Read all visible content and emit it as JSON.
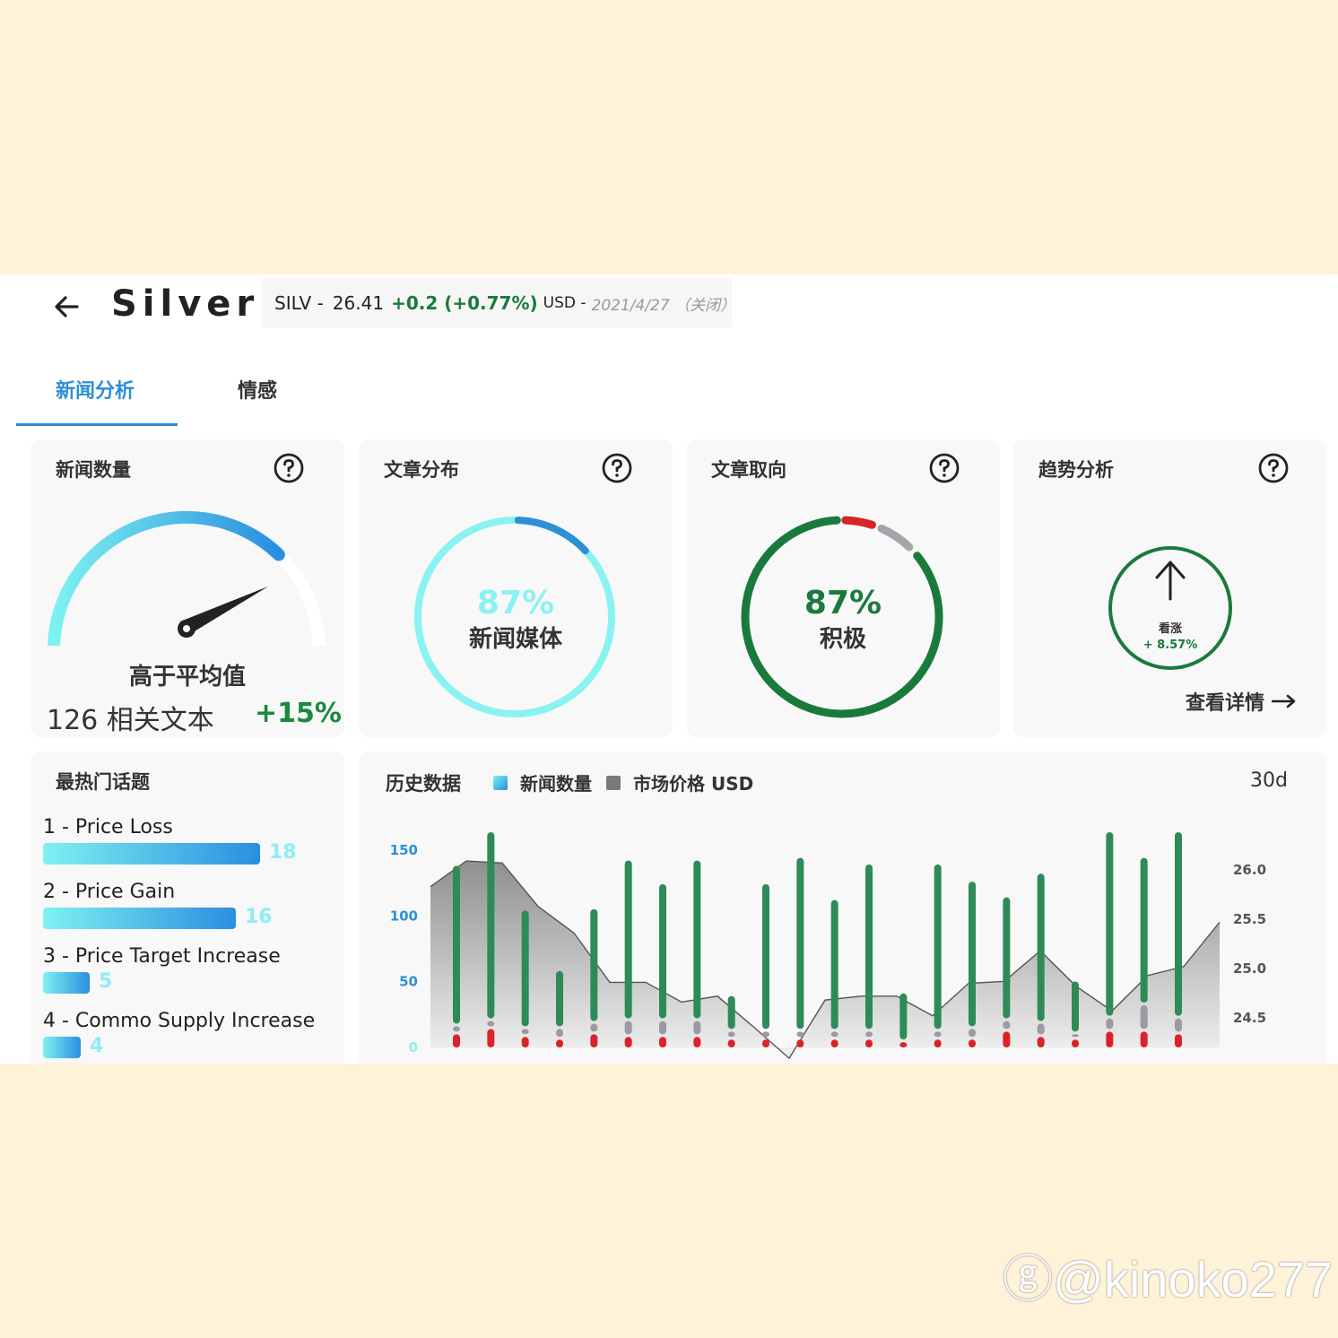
{
  "header": {
    "title": "Silver",
    "ticker": {
      "symbol": "SILV -",
      "price": "26.41",
      "change": "+0.2 (+0.77%)",
      "currency": "USD -",
      "date": "2021/4/27 （关闭）"
    }
  },
  "tabs": [
    {
      "label": "新闻分析",
      "active": true
    },
    {
      "label": "情感",
      "active": false
    }
  ],
  "cards": {
    "news_count": {
      "title": "新闻数量",
      "gauge_level": 0.72,
      "status": "高于平均值",
      "total": "126 相关文本",
      "change": "+15%"
    },
    "distribution": {
      "title": "文章分布",
      "percent": "87%",
      "label": "新闻媒体",
      "share": 0.87
    },
    "orientation": {
      "title": "文章取向",
      "percent": "87%",
      "label": "积极",
      "positive_share": 0.87
    },
    "trend": {
      "title": "趋势分析",
      "label": "看涨",
      "value": "+ 8.57%",
      "link": "查看详情"
    }
  },
  "topics": {
    "title": "最热门话题",
    "items": [
      {
        "name": "1 - Price Loss",
        "value": "18",
        "count": 18
      },
      {
        "name": "2 - Price Gain",
        "value": "16",
        "count": 16
      },
      {
        "name": "3 - Price Target Increase",
        "value": "5",
        "count": 5
      },
      {
        "name": "4 - Commo Supply Increase",
        "value": "4",
        "count": 4
      }
    ]
  },
  "history": {
    "title": "历史数据",
    "legend_news": "新闻数量",
    "legend_price": "市场价格 USD",
    "range": "30d"
  },
  "colors": {
    "accent": "#2d8fd5",
    "positive": "#1a7a3c",
    "negative": "#d8232a",
    "neutral": "#9a9aa0",
    "cyan": "#7df2f1"
  },
  "icons": {
    "back": "arrow-left-icon",
    "help": "question-circle-icon",
    "trend": "arrow-up-icon",
    "link": "arrow-right-icon"
  },
  "chart_data": {
    "type": "bar",
    "title": "",
    "left_axis": {
      "ticks": [
        "150",
        "100",
        "50",
        "0"
      ],
      "ylim": [
        0,
        150
      ]
    },
    "right_axis": {
      "ticks": [
        "26.0",
        "25.5",
        "25.0",
        "24.5"
      ],
      "ylim": [
        24.2,
        26.2
      ]
    },
    "series": [
      {
        "name": "新闻数量",
        "kind": "bar-positive",
        "values": [
          120,
          168,
          88,
          42,
          85,
          120,
          102,
          120,
          25,
          110,
          130,
          98,
          125,
          35,
          125,
          110,
          92,
          112,
          38,
          145,
          110,
          140
        ]
      },
      {
        "name": "neutral",
        "kind": "bar-neutral",
        "values": [
          4,
          4,
          4,
          6,
          6,
          10,
          10,
          10,
          4,
          4,
          4,
          4,
          4,
          0,
          4,
          6,
          6,
          8,
          2,
          8,
          18,
          10
        ]
      },
      {
        "name": "negative",
        "kind": "bar-negative",
        "values": [
          10,
          14,
          8,
          6,
          10,
          8,
          8,
          8,
          6,
          6,
          6,
          6,
          6,
          4,
          6,
          6,
          12,
          8,
          6,
          12,
          12,
          10
        ]
      },
      {
        "name": "市场价格 USD",
        "kind": "area",
        "values": [
          25.83,
          26.09,
          26.07,
          25.63,
          25.36,
          24.86,
          24.86,
          24.66,
          24.72,
          24.41,
          24.09,
          24.68,
          24.72,
          24.72,
          24.52,
          24.85,
          24.87,
          25.18,
          24.82,
          24.57,
          24.93,
          25.02,
          25.47
        ]
      }
    ]
  }
}
